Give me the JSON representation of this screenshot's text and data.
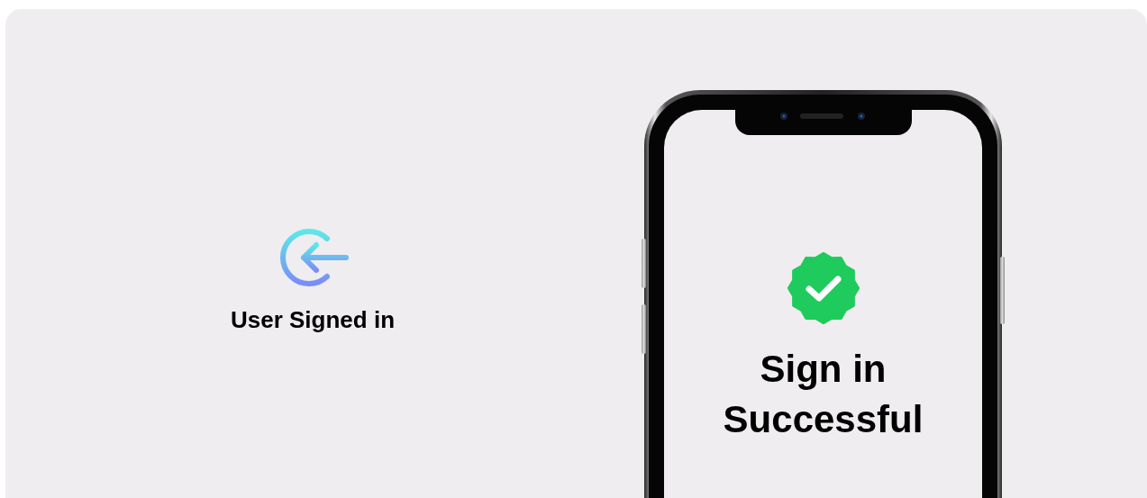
{
  "login_panel": {
    "caption": "User Signed in"
  },
  "phone": {
    "message": "Sign in Successful"
  }
}
